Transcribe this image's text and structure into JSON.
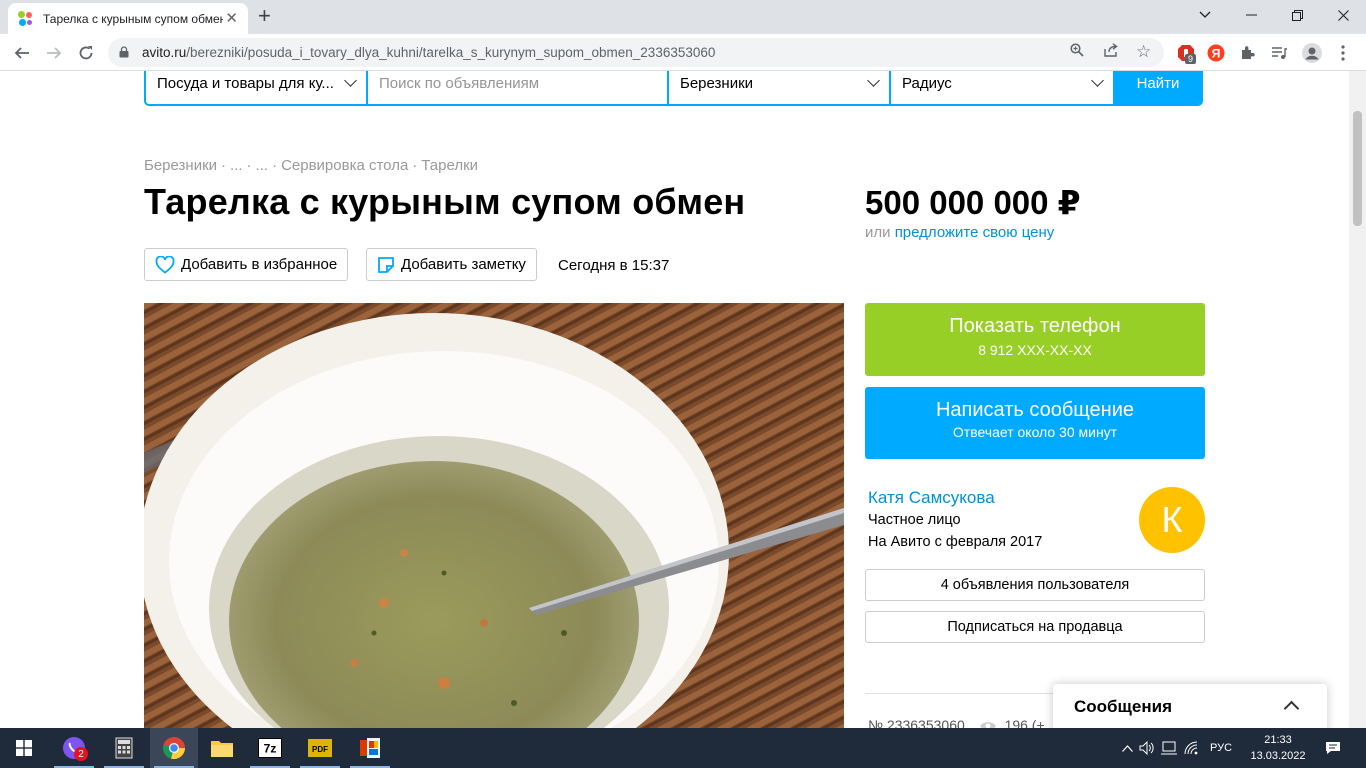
{
  "browser": {
    "tab_title": "Тарелка с курыным супом обмен",
    "url_host": "avito.ru",
    "url_path": "/berezniki/posuda_i_tovary_dlya_kuhni/tarelka_s_kurynym_supom_obmen_2336353060",
    "extension_badge": "9"
  },
  "search": {
    "category": "Посуда и товары для ку...",
    "query_placeholder": "Поиск по объявлениям",
    "city": "Березники",
    "radius": "Радиус",
    "submit": "Найти"
  },
  "breadcrumbs": [
    "Березники",
    "·",
    "...",
    "·",
    "...",
    "·",
    "Сервировка стола",
    "·",
    "Тарелки"
  ],
  "listing": {
    "title": "Тарелка с курыным супом обмен",
    "price": "500 000 000 ₽",
    "price_or": "или",
    "price_offer": "предложите свою цену",
    "fav_label": "Добавить в избранное",
    "note_label": "Добавить заметку",
    "posted": "Сегодня в 15:37",
    "ad_number": "№ 2336353060",
    "views": "196 (+"
  },
  "contact": {
    "phone_label": "Показать телефон",
    "phone_masked": "8 912 XXX-XX-XX",
    "message_label": "Написать сообщение",
    "message_sub": "Отвечает около 30 минут"
  },
  "seller": {
    "name": "Катя Самсукова",
    "type": "Частное лицо",
    "since": "На Авито с февраля 2017",
    "avatar_letter": "К",
    "ads_link": "4 объявления пользователя",
    "subscribe": "Подписаться на продавца"
  },
  "chat": {
    "title": "Сообщения"
  },
  "taskbar": {
    "viber_badge": "2",
    "lang": "РУС",
    "time": "21:33",
    "date": "13.03.2022"
  },
  "colors": {
    "accent_blue": "#00aaff",
    "phone_green": "#97cf26",
    "link_blue": "#0091d9",
    "avatar_yellow": "#ffc200"
  }
}
